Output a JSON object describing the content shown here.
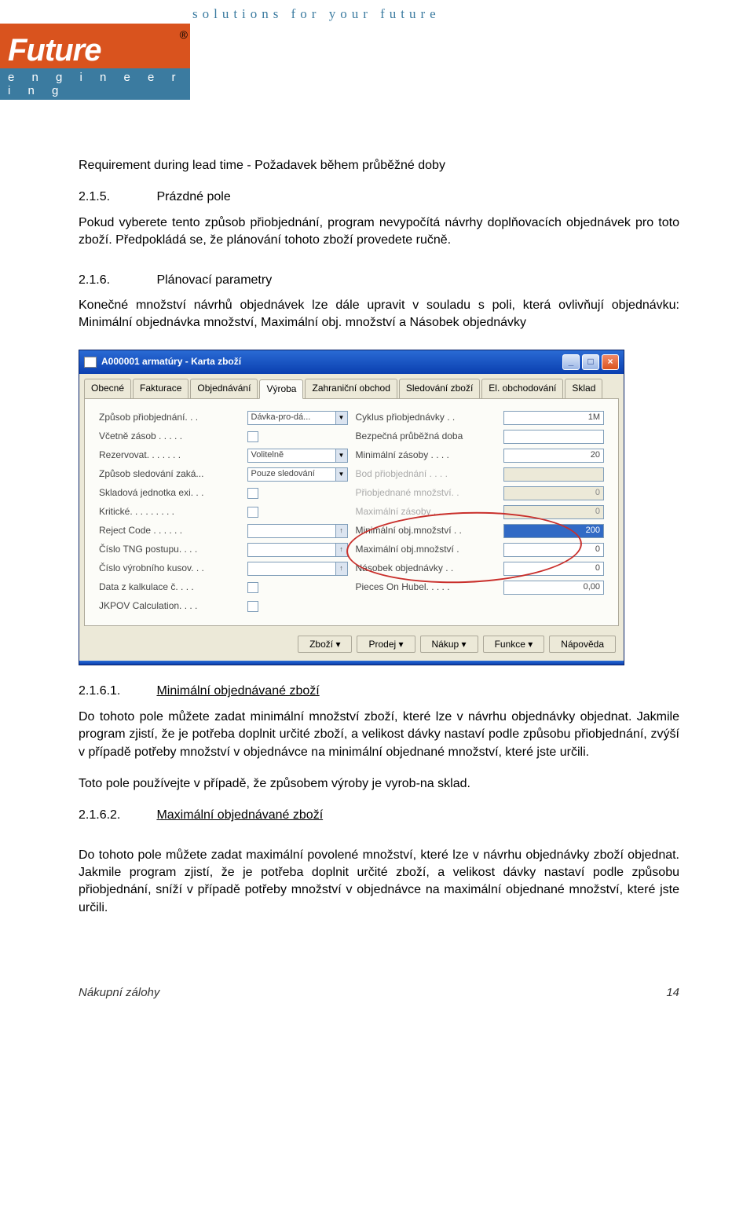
{
  "header": {
    "tagline": "solutions for your future",
    "logo_name": "Future",
    "logo_reg": "®",
    "logo_sub": "e n g i n e e r i n g"
  },
  "body": {
    "line1": "Requirement during lead time -  Požadavek  během průběžné doby",
    "s215_num": "2.1.5.",
    "s215_title": "Prázdné pole",
    "s215_p": "Pokud vyberete tento způsob přiobjednání, program nevypočítá návrhy doplňovacích objednávek pro toto zboží. Předpokládá se, že plánování tohoto zboží provedete ručně.",
    "s216_num": "2.1.6.",
    "s216_title": "Plánovací parametry",
    "s216_p": "Konečné množství návrhů objednávek lze dále upravit v souladu s poli, která ovlivňují objednávku: Minimální objednávka množství, Maximální obj. množství a Násobek objednávky",
    "s2161_num": "2.1.6.1.",
    "s2161_title": "Minimální objednávané zboží",
    "s2161_p1": "Do tohoto pole můžete zadat minimální množství zboží, které lze v návrhu objednávky objednat. Jakmile program zjistí, že je potřeba doplnit určité zboží, a velikost dávky nastaví podle způsobu přiobjednání, zvýší v případě potřeby množství v objednávce na minimální objednané množství, které jste určili.",
    "s2161_p2": "Toto pole používejte v případě, že způsobem výroby je vyrob-na sklad.",
    "s2162_num": "2.1.6.2.",
    "s2162_title": "Maximální objednávané zboží",
    "s2162_p": "Do tohoto pole můžete zadat maximální povolené množství, které lze v návrhu objednávky zboží objednat. Jakmile program zjistí, že je potřeba doplnit určité zboží, a velikost dávky nastaví podle způsobu přiobjednání, sníží v případě potřeby množství v objednávce na maximální objednané množství, které jste určili."
  },
  "win": {
    "title": "A000001 armatúry - Karta zboží",
    "tabs": [
      "Obecné",
      "Fakturace",
      "Objednávání",
      "Výroba",
      "Zahraniční obchod",
      "Sledování zboží",
      "El. obchodování",
      "Sklad"
    ],
    "active_tab": 3,
    "left": {
      "priobj_label": "Způsob přiobjednání. . .",
      "priobj_val": "Dávka-pro-dá...",
      "vcetne_label": "Včetně zásob . . . . .",
      "rezervovat_label": "Rezervovat. . . . . . .",
      "rezervovat_val": "Volitelně",
      "sledovani_label": "Způsob sledování zaká...",
      "sledovani_val": "Pouze sledování",
      "jednotka_label": "Skladová jednotka exi. . .",
      "kriticke_label": "Kritické. . . . . . . . .",
      "reject_label": "Reject Code . . . . . .",
      "tng_label": "Číslo TNG postupu. . . .",
      "vyrob_label": "Číslo výrobního kusov. . .",
      "kalk_label": "Data z kalkulace č. . . .",
      "jkpov_label": "JKPOV Calculation. . . ."
    },
    "right": {
      "cyklus_label": "Cyklus přiobjednávky . .",
      "cyklus_val": "1M",
      "bezpecna_label": "Bezpečná průběžná doba",
      "minzas_label": "Minimální zásoby . . . .",
      "minzas_val": "20",
      "bod_label": "Bod přiobjednání . . . .",
      "priobjmn_label": "Přiobjednané množství. .",
      "priobjmn_val": "0",
      "maxzas_label": "Maximální zásoby . . . .",
      "maxzas_val": "0",
      "minobj_label": "Minimální obj.množství . .",
      "minobj_val": "200",
      "maxobj_label": "Maximální obj.množství .",
      "maxobj_val": "0",
      "nasobek_label": "Násobek objednávky . .",
      "nasobek_val": "0",
      "pieces_label": "Pieces On Hubel. . . . .",
      "pieces_val": "0,00"
    },
    "buttons": {
      "zbozi": "Zboží",
      "prodej": "Prodej",
      "nakup": "Nákup",
      "funkce": "Funkce",
      "napoveda": "Nápověda"
    }
  },
  "footer": {
    "left": "Nákupní zálohy",
    "right": "14"
  }
}
